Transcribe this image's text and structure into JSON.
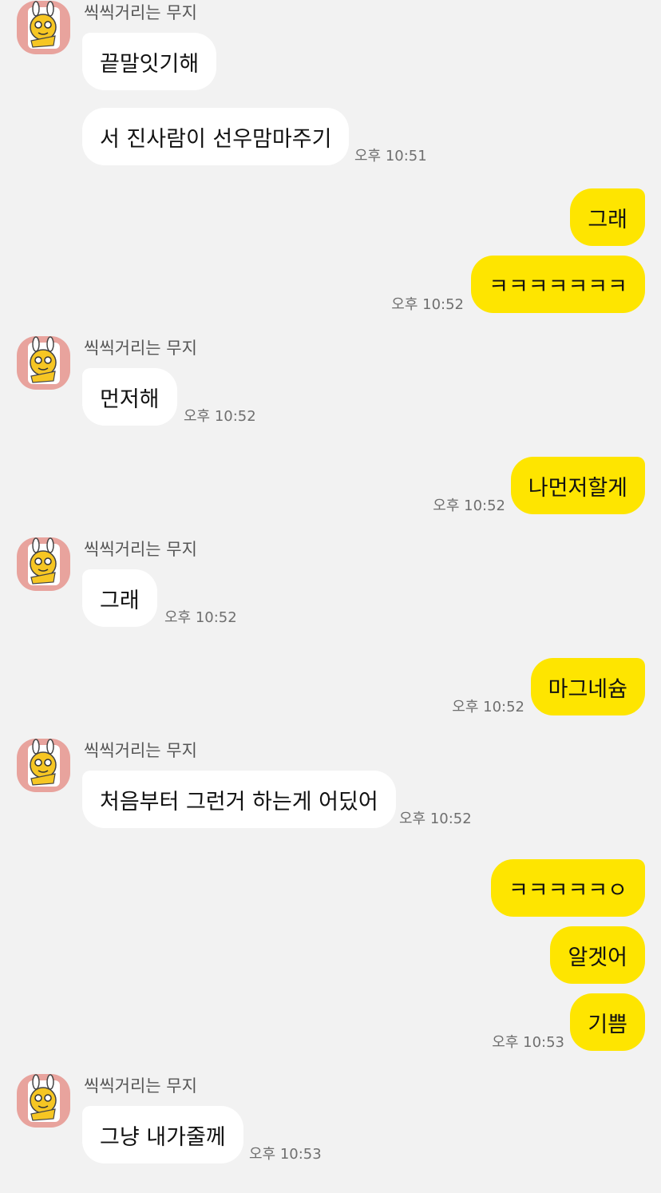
{
  "colors": {
    "background": "#f2f2f2",
    "incoming_bubble": "#ffffff",
    "outgoing_bubble": "#fee500",
    "avatar_bg": "#e8a39d"
  },
  "sender_name": "씩씩거리는 무지",
  "avatar_icon": "muzi-character-icon",
  "messages": [
    {
      "direction": "in",
      "text": "끝말잇기해"
    },
    {
      "direction": "in",
      "text": "서 진사람이 선우맘마주기",
      "time": "오후 10:51"
    },
    {
      "direction": "out",
      "text": "그래"
    },
    {
      "direction": "out",
      "text": "ㅋㅋㅋㅋㅋㅋㅋ",
      "time": "오후 10:52"
    },
    {
      "direction": "in",
      "text": "먼저해",
      "time": "오후 10:52"
    },
    {
      "direction": "out",
      "text": "나먼저할게",
      "time": "오후 10:52"
    },
    {
      "direction": "in",
      "text": "그래",
      "time": "오후 10:52"
    },
    {
      "direction": "out",
      "text": "마그네슘",
      "time": "오후 10:52"
    },
    {
      "direction": "in",
      "text": "처음부터 그런거 하는게 어딨어",
      "time": "오후 10:52"
    },
    {
      "direction": "out",
      "text": "ㅋㅋㅋㅋㅋㅇ"
    },
    {
      "direction": "out",
      "text": "알겟어"
    },
    {
      "direction": "out",
      "text": "기쁨",
      "time": "오후 10:53"
    },
    {
      "direction": "in",
      "text": "그냥 내가줄께",
      "time": "오후 10:53"
    }
  ]
}
